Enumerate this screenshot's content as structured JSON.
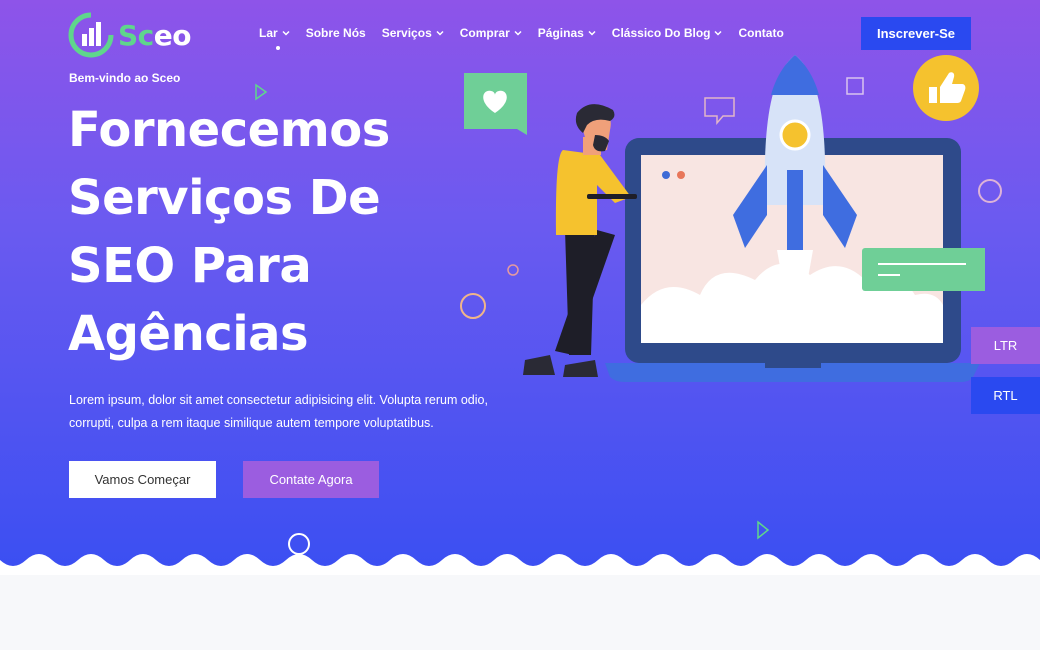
{
  "brand": {
    "logo_text_accent": "Sc",
    "logo_text_rest": "eo"
  },
  "nav": {
    "items": [
      {
        "label": "Lar",
        "has_dropdown": true,
        "active": true
      },
      {
        "label": "Sobre Nós",
        "has_dropdown": false
      },
      {
        "label": "Serviços",
        "has_dropdown": true
      },
      {
        "label": "Comprar",
        "has_dropdown": true
      },
      {
        "label": "Páginas",
        "has_dropdown": true
      },
      {
        "label": "Clássico Do Blog",
        "has_dropdown": true
      },
      {
        "label": "Contato",
        "has_dropdown": false
      }
    ],
    "signup_label": "Inscrever-Se"
  },
  "hero": {
    "welcome": "Bem-vindo ao Sceo",
    "headline": "Fornecemos Serviços De SEO Para Agências",
    "description": "Lorem ipsum, dolor sit amet consectetur adipisicing elit. Volupta rerum odio, corrupti, culpa a rem itaque similique autem tempore voluptatibus.",
    "primary_button": "Vamos Começar",
    "secondary_button": "Contate Agora"
  },
  "direction_switcher": {
    "ltr": "LTR",
    "rtl": "RTL"
  },
  "colors": {
    "gradient_top": "#8e54e9",
    "gradient_bottom": "#3b4ff2",
    "accent_blue": "#2a49f0",
    "accent_purple": "#9b5de0",
    "logo_green": "#5fd68c"
  },
  "icons": [
    "logo-chart-icon",
    "chevron-down-icon",
    "heart-chat-icon",
    "thumbs-up-icon",
    "rocket-icon",
    "play-triangle-icon"
  ]
}
